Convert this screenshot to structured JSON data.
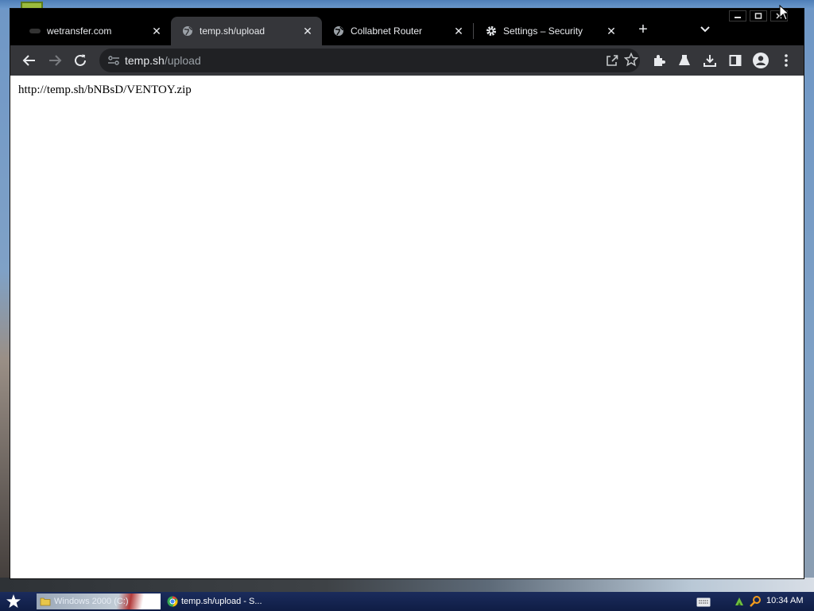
{
  "window": {
    "tabs": [
      {
        "title": "wetransfer.com",
        "favicon": "wetransfer-icon",
        "active": false
      },
      {
        "title": "temp.sh/upload",
        "favicon": "globe-icon",
        "active": true
      },
      {
        "title": "Collabnet Router",
        "favicon": "globe-icon",
        "active": false
      },
      {
        "title": "Settings – Security",
        "favicon": "gear-icon",
        "active": false
      }
    ],
    "new_tab_symbol": "+",
    "close_symbol": "✕"
  },
  "toolbar": {
    "url_host": "temp.sh",
    "url_path": "/upload"
  },
  "page": {
    "text": "http://temp.sh/bNBsD/VENTOY.zip"
  },
  "taskbar": {
    "items": [
      {
        "label": "Windows 2000 (C:)",
        "icon": "folder-icon"
      },
      {
        "label": "temp.sh/upload - S...",
        "icon": "chrome-icon"
      }
    ],
    "clock": "10:34 AM"
  },
  "colors": {
    "tabstrip": "#000000",
    "toolbar": "#35363a",
    "omnibox": "#202124",
    "taskbar": "#0f1d45"
  }
}
